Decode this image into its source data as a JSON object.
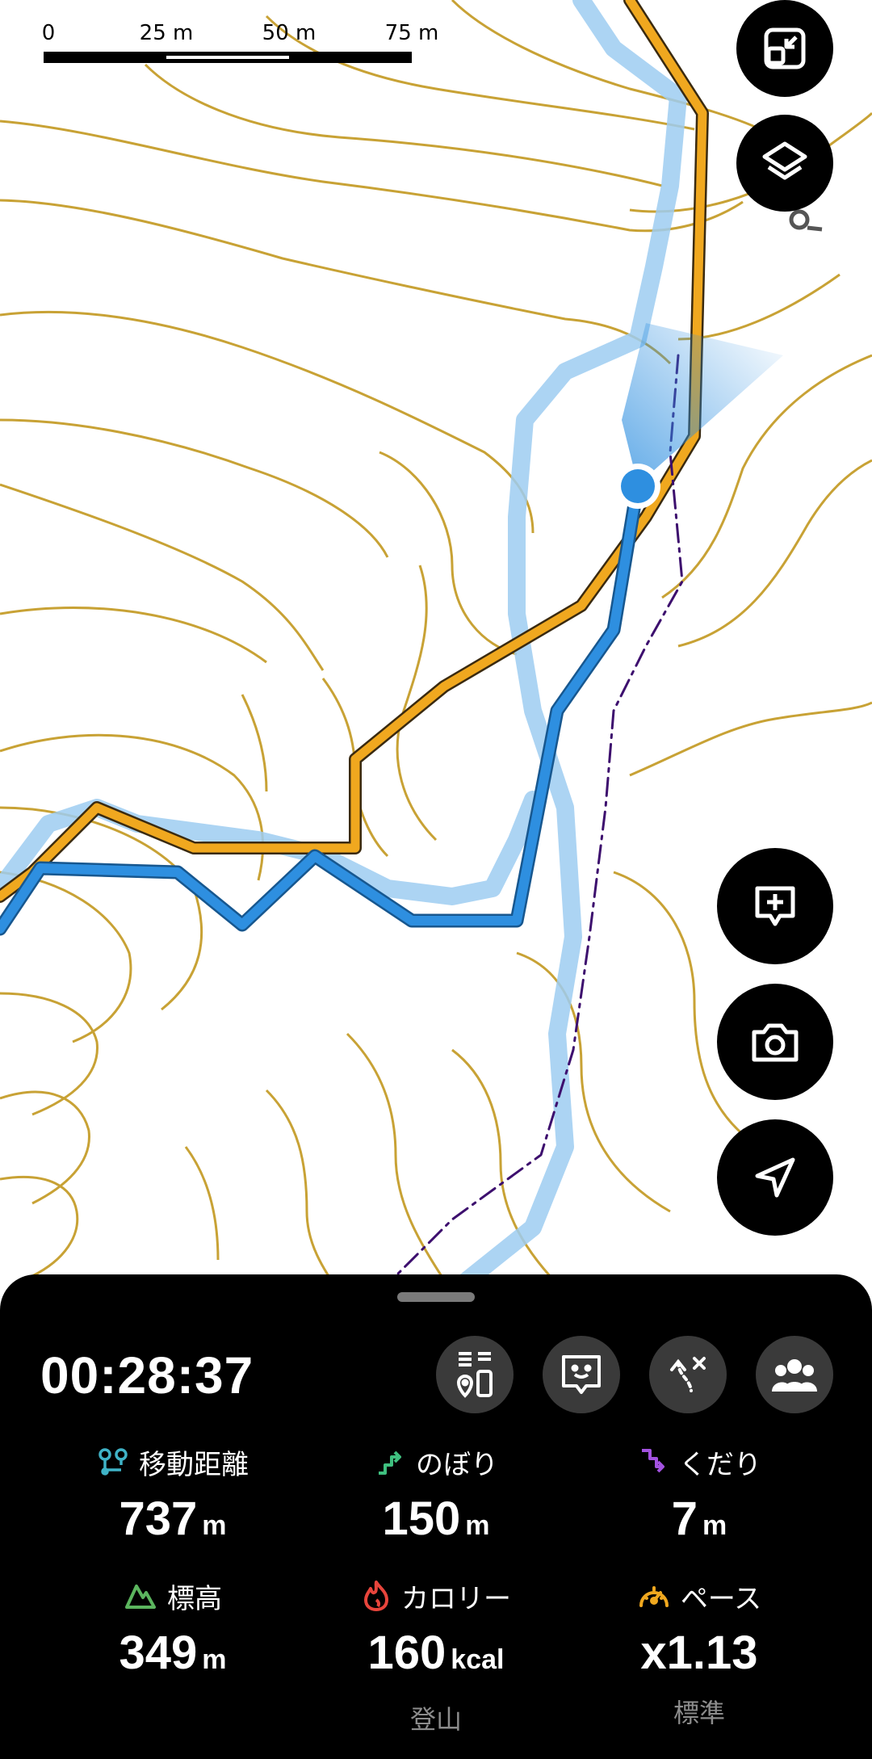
{
  "scale_bar": {
    "labels": [
      "0",
      "25 m",
      "50 m",
      "75 m"
    ]
  },
  "map_buttons": [
    {
      "name": "minimize-map-button",
      "icon": "minimize-icon"
    },
    {
      "name": "layers-button",
      "icon": "layers-icon"
    },
    {
      "name": "add-note-button",
      "icon": "add-note-icon"
    },
    {
      "name": "camera-button",
      "icon": "camera-icon"
    },
    {
      "name": "navigate-button",
      "icon": "navigation-arrow-icon"
    }
  ],
  "colors": {
    "contour": "#c8a235",
    "planned_route": "#f0a81f",
    "track": "#2e8fe0",
    "alt_route": "#9ecdf1",
    "trail": "#3d0f6e",
    "sheet_bg": "#000000"
  },
  "panel": {
    "elapsed_time": "00:28:37",
    "tools": [
      {
        "name": "altitude-tool-button",
        "icon": "altitude-bars-icon"
      },
      {
        "name": "chat-tool-button",
        "icon": "chat-face-icon"
      },
      {
        "name": "route-tool-button",
        "icon": "route-off-icon"
      },
      {
        "name": "group-tool-button",
        "icon": "group-icon"
      }
    ],
    "stats": {
      "distance": {
        "label": "移動距離",
        "value": "737",
        "unit": "m",
        "icon": "route-icon"
      },
      "ascent": {
        "label": "のぼり",
        "value": "150",
        "unit": "m",
        "icon": "ascent-icon"
      },
      "descent": {
        "label": "くだり",
        "value": "7",
        "unit": "m",
        "icon": "descent-icon"
      },
      "elevation": {
        "label": "標高",
        "value": "349",
        "unit": "m",
        "icon": "mountain-icon"
      },
      "calories": {
        "label": "カロリー",
        "value": "160",
        "unit": "kcal",
        "sub": "登山",
        "icon": "flame-icon"
      },
      "pace": {
        "label": "ペース",
        "value": "x1.13",
        "unit": "",
        "sub": "標準",
        "icon": "speedometer-icon"
      }
    }
  }
}
